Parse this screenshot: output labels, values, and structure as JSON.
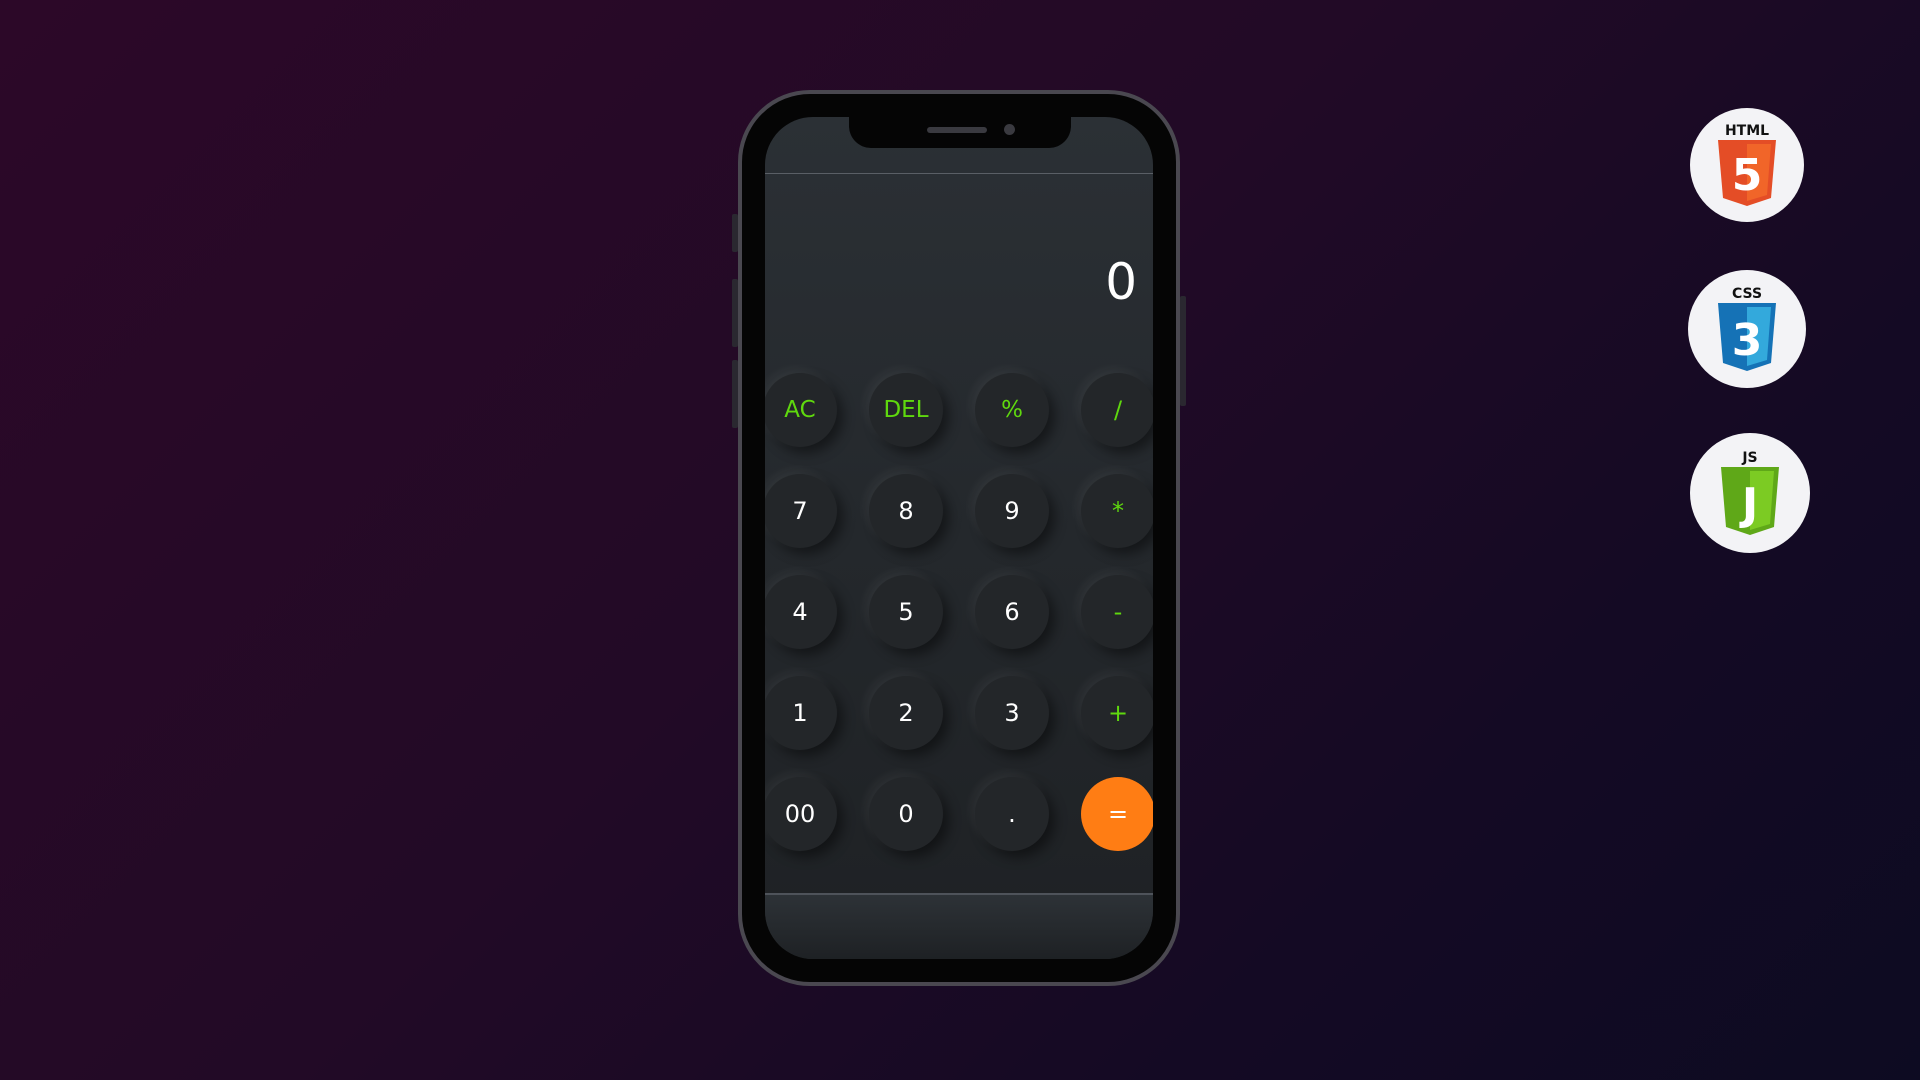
{
  "calculator": {
    "display_value": "0",
    "rows": [
      [
        {
          "label": "AC",
          "kind": "fn"
        },
        {
          "label": "DEL",
          "kind": "fn"
        },
        {
          "label": "%",
          "kind": "fn"
        },
        {
          "label": "/",
          "kind": "op"
        }
      ],
      [
        {
          "label": "7",
          "kind": "num"
        },
        {
          "label": "8",
          "kind": "num"
        },
        {
          "label": "9",
          "kind": "num"
        },
        {
          "label": "*",
          "kind": "op"
        }
      ],
      [
        {
          "label": "4",
          "kind": "num"
        },
        {
          "label": "5",
          "kind": "num"
        },
        {
          "label": "6",
          "kind": "num"
        },
        {
          "label": "-",
          "kind": "op"
        }
      ],
      [
        {
          "label": "1",
          "kind": "num"
        },
        {
          "label": "2",
          "kind": "num"
        },
        {
          "label": "3",
          "kind": "num"
        },
        {
          "label": "+",
          "kind": "op"
        }
      ],
      [
        {
          "label": "00",
          "kind": "num"
        },
        {
          "label": "0",
          "kind": "num"
        },
        {
          "label": ".",
          "kind": "num"
        },
        {
          "label": "=",
          "kind": "eq"
        }
      ]
    ]
  },
  "badges": {
    "html": {
      "label": "HTML",
      "number": "5",
      "icon": "html5-icon"
    },
    "css": {
      "label": "CSS",
      "number": "3",
      "icon": "css3-icon"
    },
    "js": {
      "label": "JS",
      "letter": "J",
      "icon": "javascript-icon"
    }
  },
  "colors": {
    "operator_green": "#5fd80e",
    "equals_orange": "#ff7d14",
    "html_orange": "#e44d26",
    "css_blue": "#1572b6",
    "js_green": "#6ebd1f"
  }
}
